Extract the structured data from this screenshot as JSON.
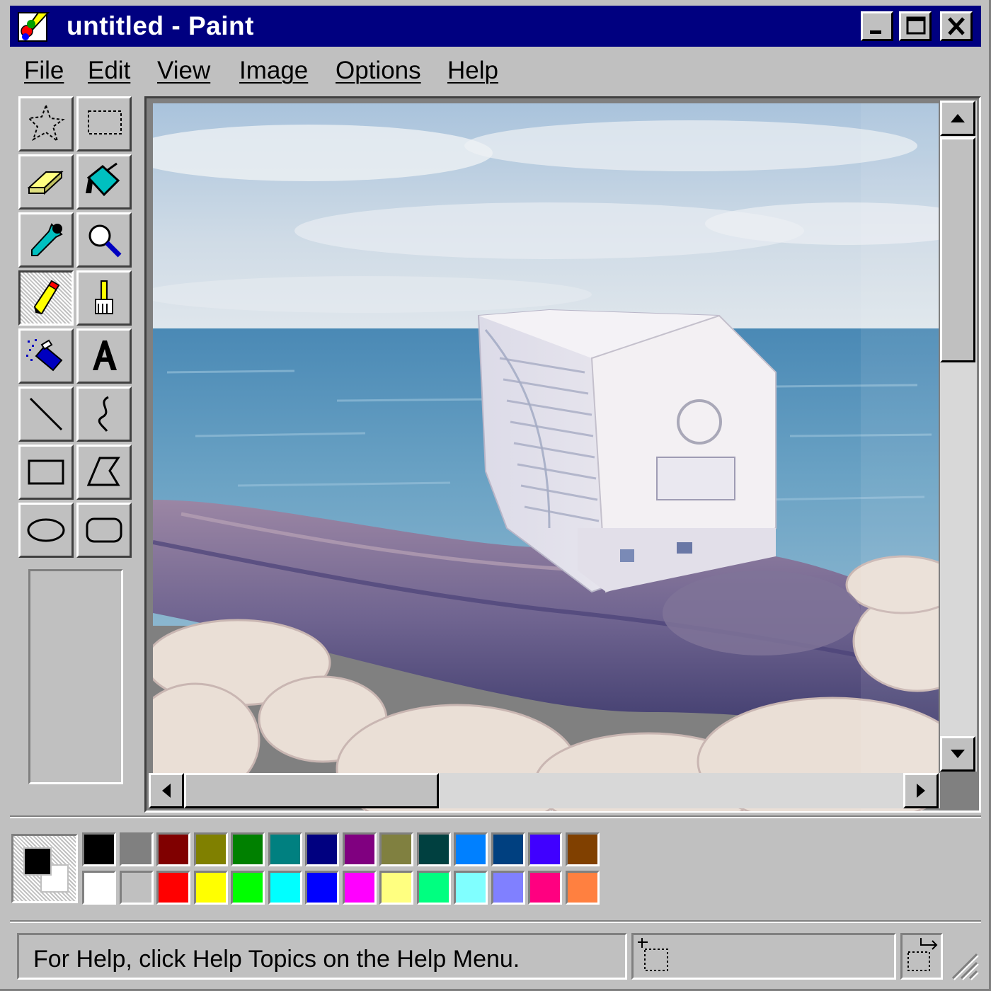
{
  "window": {
    "title": "untitled - Paint",
    "colors": {
      "titlebar": "#000080",
      "face": "#c0c0c0"
    }
  },
  "menu": [
    "File",
    "Edit",
    "View",
    "Image",
    "Options",
    "Help"
  ],
  "tools": [
    {
      "name": "free-form-select",
      "icon": "free-form-select-icon",
      "active": false
    },
    {
      "name": "select",
      "icon": "rectangle-select-icon",
      "active": false
    },
    {
      "name": "eraser",
      "icon": "eraser-icon",
      "active": false
    },
    {
      "name": "fill-with-color",
      "icon": "paint-bucket-icon",
      "active": false
    },
    {
      "name": "pick-color",
      "icon": "eyedropper-icon",
      "active": false
    },
    {
      "name": "magnifier",
      "icon": "magnifier-icon",
      "active": false
    },
    {
      "name": "pencil",
      "icon": "pencil-icon",
      "active": true
    },
    {
      "name": "brush",
      "icon": "brush-icon",
      "active": false
    },
    {
      "name": "airbrush",
      "icon": "airbrush-icon",
      "active": false
    },
    {
      "name": "text",
      "icon": "text-icon",
      "glyph": "A",
      "active": false
    },
    {
      "name": "line",
      "icon": "line-icon",
      "active": false
    },
    {
      "name": "curve",
      "icon": "curve-icon",
      "active": false
    },
    {
      "name": "rectangle",
      "icon": "rectangle-icon",
      "active": false
    },
    {
      "name": "polygon",
      "icon": "polygon-icon",
      "active": false
    },
    {
      "name": "ellipse",
      "icon": "ellipse-icon",
      "active": false
    },
    {
      "name": "rounded-rectangle",
      "icon": "rounded-rectangle-icon",
      "active": false
    }
  ],
  "palette": {
    "foreground": "#000000",
    "background": "#ffffff",
    "top_row": [
      "#000000",
      "#808080",
      "#800000",
      "#808000",
      "#008000",
      "#008080",
      "#000080",
      "#800080",
      "#808040",
      "#004040",
      "#0080ff",
      "#004080",
      "#4000ff",
      "#804000"
    ],
    "bottom_row": [
      "#ffffff",
      "#c0c0c0",
      "#ff0000",
      "#ffff00",
      "#00ff00",
      "#00ffff",
      "#0000ff",
      "#ff00ff",
      "#ffff80",
      "#00ff80",
      "#80ffff",
      "#8080ff",
      "#ff0080",
      "#ff8040"
    ]
  },
  "status": {
    "help_text": "For Help, click Help Topics on the Help Menu."
  }
}
